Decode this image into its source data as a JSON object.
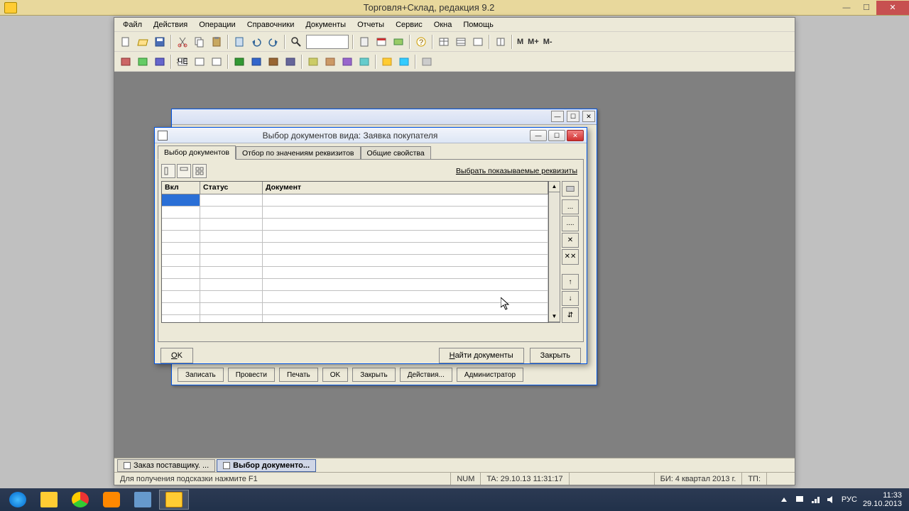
{
  "win8_title": "Торговля+Склад, редакция 9.2",
  "menu": [
    "Файл",
    "Действия",
    "Операции",
    "Справочники",
    "Документы",
    "Отчеты",
    "Сервис",
    "Окна",
    "Помощь"
  ],
  "tb_text": {
    "m": "M",
    "mp": "M+",
    "mm": "M-"
  },
  "bg_buttons": [
    "Записать",
    "Провести",
    "Печать",
    "OK",
    "Закрыть",
    "Действия...",
    "Администратор"
  ],
  "dlg": {
    "title": "Выбор документов вида:  Заявка покупателя",
    "tabs": [
      "Выбор документов",
      "Отбор по значениям реквизитов",
      "Общие свойства"
    ],
    "link": "Выбрать показываемые реквизиты",
    "cols": {
      "c1": "Вкл",
      "c2": "Статус",
      "c3": "Документ"
    },
    "side": {
      "dots": "...",
      "ddots": "....",
      "x": "✕",
      "xx": "✕✕",
      "up": "↑",
      "down": "↓",
      "sort": "⇵"
    },
    "ok": "OK",
    "find": "Найти документы",
    "close": "Закрыть"
  },
  "mdi_tabs": [
    {
      "label": "Заказ поставщику. ...",
      "active": false
    },
    {
      "label": "Выбор документо...",
      "active": true
    }
  ],
  "status": {
    "hint": "Для получения подсказки нажмите F1",
    "num": "NUM",
    "ta": "TA: 29.10.13  11:31:17",
    "bi": "БИ: 4 квартал 2013 г.",
    "tp": "ТП:"
  },
  "tray": {
    "lang": "РУС",
    "time": "11:33",
    "date": "29.10.2013"
  }
}
